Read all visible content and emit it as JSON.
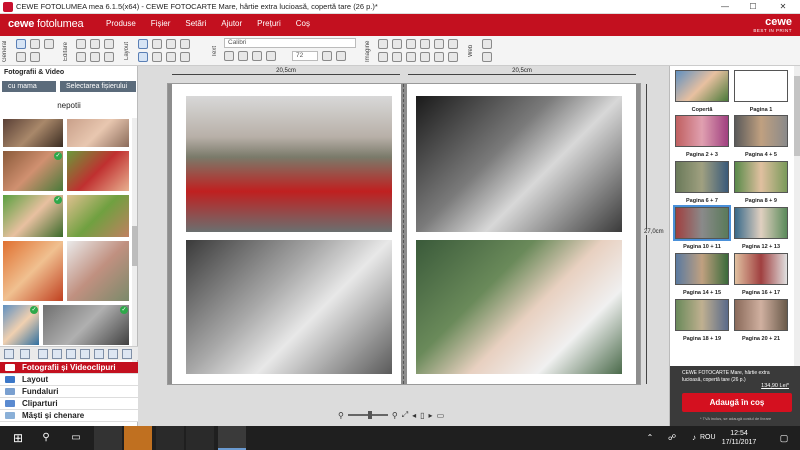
{
  "window": {
    "title": "CEWE FOTOLUMEA mea 6.1.5(x64) - CEWE FOTOCARTE Mare, hârtie extra lucioasă, copertă tare (26 p.)*",
    "min": "—",
    "max": "☐",
    "close": "✕"
  },
  "menubar": {
    "logo_bold": "cewe",
    "logo_rest": " fotolumea",
    "items": [
      "Produse",
      "Fișier",
      "Setări",
      "Ajutor",
      "Prețuri",
      "Coș"
    ],
    "brand": "cewe",
    "brand_sub": "BEST IN PRINT"
  },
  "toolbar": {
    "groups": [
      "General",
      "Editare",
      "Layout",
      "Text",
      "Imagine",
      "Web"
    ],
    "font": "Calibri",
    "font_size": "72"
  },
  "left": {
    "header": "Fotografii & Video",
    "btn_mama": "cu mama",
    "btn_select": "Selectarea fișierului",
    "folder": "nepotii",
    "nav": [
      "Fotografii și Videoclipuri",
      "Layout",
      "Fundaluri",
      "Cliparturi",
      "Măști și chenare"
    ]
  },
  "canvas": {
    "ruler_left": "20,5cm",
    "ruler_right": "20,5cm",
    "ruler_height": "27,0cm"
  },
  "pages": {
    "labels": [
      "Copertă",
      "Pagina 1",
      "Pagina 2 + 3",
      "Pagina 4 + 5",
      "Pagina 6 + 7",
      "Pagina 8 + 9",
      "Pagina 10 + 11",
      "Pagina 12 + 13",
      "Pagina 14 + 15",
      "Pagina 16 + 17",
      "Pagina 18 + 19",
      "Pagina 20 + 21"
    ],
    "selected": "Pagina 10 + 11"
  },
  "cart": {
    "product": "CEWE FOTOCARTE Mare, hârtie extra lucioasă, copertă tare (26 p.)",
    "price": "134,90 Lei*",
    "add": "Adaugă în coș",
    "note": "* TVA inclus, se adaugă costul de livrare"
  },
  "taskbar": {
    "time": "12:54",
    "date": "17/11/2017",
    "lang": "ROU"
  },
  "colors": {
    "brand_red": "#c3101f",
    "nav_selected": "#c3101f"
  }
}
